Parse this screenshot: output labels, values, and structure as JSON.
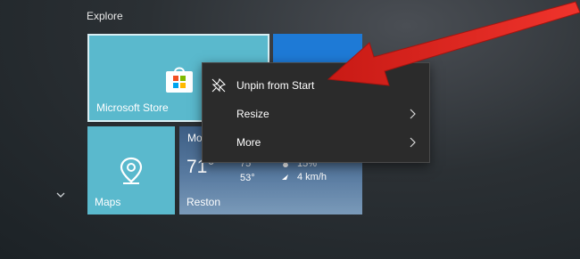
{
  "group": {
    "title": "Explore"
  },
  "tiles": {
    "store": {
      "label": "Microsoft Store"
    },
    "maps": {
      "label": "Maps"
    },
    "weather": {
      "label": "Reston",
      "city_top": "Mo",
      "temperature": "71°",
      "high": "75°",
      "low": "53°",
      "humidity": "15%",
      "wind": "4 km/h"
    }
  },
  "context_menu": {
    "items": [
      {
        "label": "Unpin from Start",
        "icon": "unpin-icon"
      },
      {
        "label": "Resize",
        "icon": "chevron-right-icon"
      },
      {
        "label": "More",
        "icon": "chevron-right-icon"
      }
    ]
  },
  "colors": {
    "tile_teal": "#5ab9cd",
    "tile_blue": "#1e7ad6",
    "menu_bg": "#2b2b2b",
    "annotation_arrow": "#e8251f"
  }
}
